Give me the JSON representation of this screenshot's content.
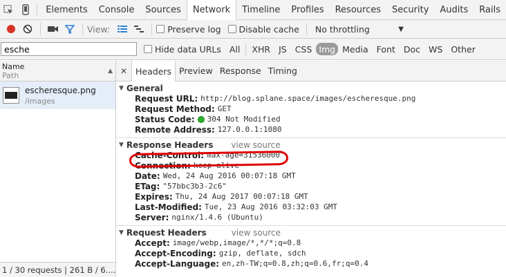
{
  "tabs": {
    "items": [
      "Elements",
      "Console",
      "Sources",
      "Network",
      "Timeline",
      "Profiles",
      "Resources",
      "Security",
      "Audits",
      "Rails"
    ],
    "active": "Network"
  },
  "toolbar": {
    "view_label": "View:",
    "preserve_log": "Preserve log",
    "disable_cache": "Disable cache",
    "throttling": "No throttling",
    "colors": {
      "record": "#d93025",
      "filter_active": "#2a7fd6"
    }
  },
  "filterbar": {
    "search_value": "esche",
    "hide_data_urls": "Hide data URLs",
    "types": [
      "All",
      "XHR",
      "JS",
      "CSS",
      "Img",
      "Media",
      "Font",
      "Doc",
      "WS",
      "Other"
    ],
    "selected_type": "Img"
  },
  "requests": {
    "header_name": "Name",
    "header_path": "Path",
    "items": [
      {
        "name": "escheresque.png",
        "path": "/images"
      }
    ],
    "status": "1 / 30 requests  |  261 B / 6...."
  },
  "details": {
    "tabs": [
      "Headers",
      "Preview",
      "Response",
      "Timing"
    ],
    "active_tab": "Headers",
    "general": {
      "title": "General",
      "rows": [
        {
          "k": "Request URL:",
          "v": "http://blog.splane.space/images/escheresque.png"
        },
        {
          "k": "Request Method:",
          "v": "GET"
        },
        {
          "k": "Status Code:",
          "v": "304 Not Modified"
        },
        {
          "k": "Remote Address:",
          "v": "127.0.0.1:1080"
        }
      ]
    },
    "response_headers": {
      "title": "Response Headers",
      "view_source": "view source",
      "rows": [
        {
          "k": "Cache-Control:",
          "v": "max-age=31536000"
        },
        {
          "k": "Connection:",
          "v": "keep-alive"
        },
        {
          "k": "Date:",
          "v": "Wed, 24 Aug 2016 00:07:18 GMT"
        },
        {
          "k": "ETag:",
          "v": "\"57bbc3b3-2c6\""
        },
        {
          "k": "Expires:",
          "v": "Thu, 24 Aug 2017 00:07:18 GMT"
        },
        {
          "k": "Last-Modified:",
          "v": "Tue, 23 Aug 2016 03:32:03 GMT"
        },
        {
          "k": "Server:",
          "v": "nginx/1.4.6 (Ubuntu)"
        }
      ]
    },
    "request_headers": {
      "title": "Request Headers",
      "view_source": "view source",
      "rows": [
        {
          "k": "Accept:",
          "v": "image/webp,image/*,*/*;q=0.8"
        },
        {
          "k": "Accept-Encoding:",
          "v": "gzip, deflate, sdch"
        },
        {
          "k": "Accept-Language:",
          "v": "en,zh-TW;q=0.8,zh;q=0.6,fr;q=0.4"
        }
      ]
    }
  },
  "status_ok_color": "#2bb02b",
  "annotation_color": "#e00000"
}
